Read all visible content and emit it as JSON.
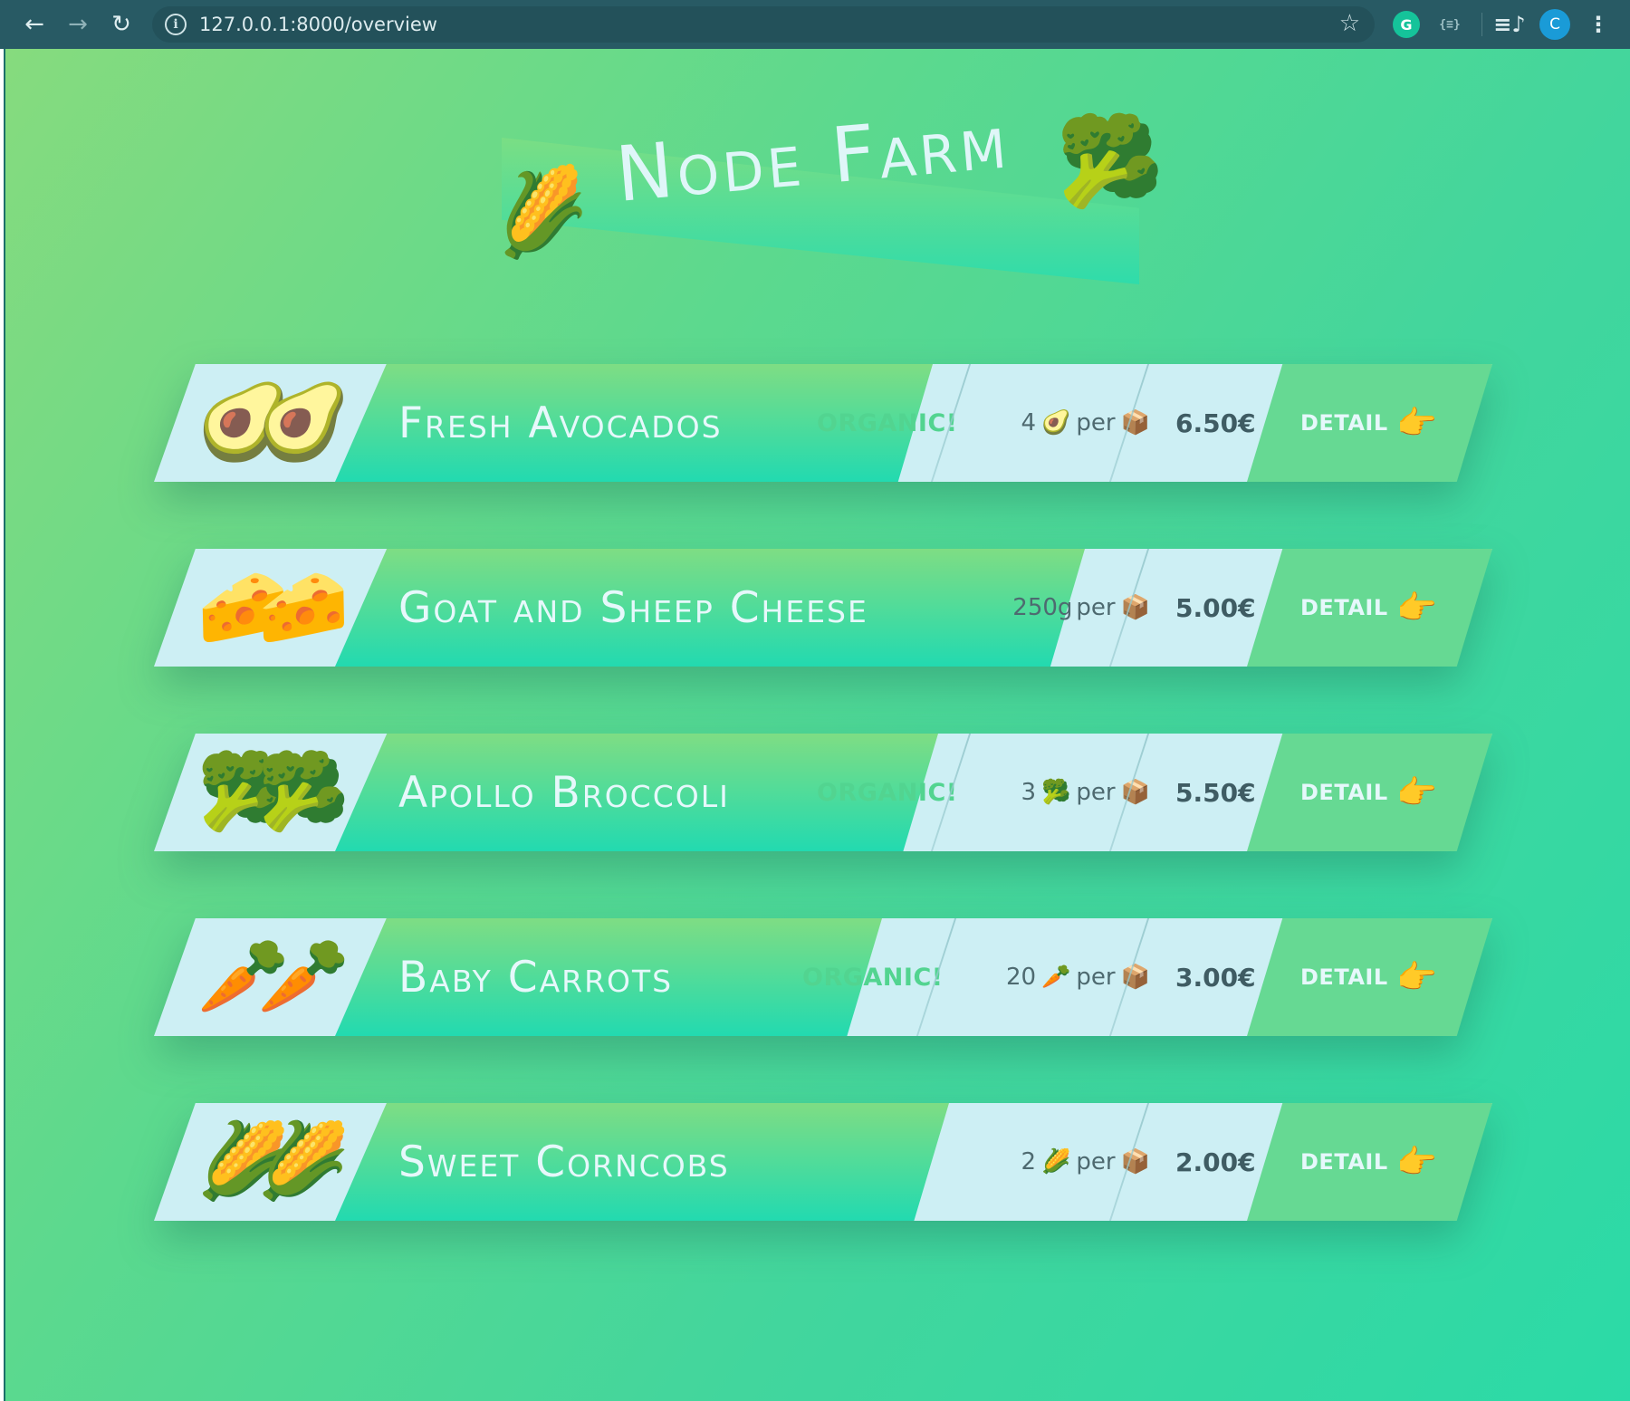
{
  "browser": {
    "back": "←",
    "forward": "→",
    "reload": "↻",
    "url": "127.0.0.1:8000/overview",
    "star": "☆",
    "ext_grammarly": "G",
    "ext_json": "{≡}",
    "ext_list": "≡♪",
    "avatar_letter": "C",
    "menu": "⋮"
  },
  "header": {
    "title": "Node Farm",
    "emoji_left": "🌽",
    "emoji_right": "🥦"
  },
  "colors": {
    "page_gradient_start": "#86db7e",
    "page_gradient_end": "#2bdaa7",
    "card_background": "#cdeff4",
    "organic_text": "#52d490",
    "detail_zone": "#66d993"
  },
  "products": [
    {
      "name": "Fresh Avocados",
      "image": "🥑🥑",
      "organic_label": "ORGANIC!",
      "quantity_amount": "4",
      "quantity_emoji": "🥑",
      "quantity_per": "per",
      "box_emoji": "📦",
      "price": "6.50€",
      "detail_label": "DETAIL",
      "detail_icon": "👉"
    },
    {
      "name": "Goat and Sheep Cheese",
      "image": "🧀🧀",
      "organic_label": "",
      "quantity_amount": "250g",
      "quantity_emoji": "",
      "quantity_per": "per",
      "box_emoji": "📦",
      "price": "5.00€",
      "detail_label": "DETAIL",
      "detail_icon": "👉"
    },
    {
      "name": "Apollo Broccoli",
      "image": "🥦🥦",
      "organic_label": "ORGANIC!",
      "quantity_amount": "3",
      "quantity_emoji": "🥦",
      "quantity_per": "per",
      "box_emoji": "📦",
      "price": "5.50€",
      "detail_label": "DETAIL",
      "detail_icon": "👉"
    },
    {
      "name": "Baby Carrots",
      "image": "🥕🥕",
      "organic_label": "ORGANIC!",
      "quantity_amount": "20",
      "quantity_emoji": "🥕",
      "quantity_per": "per",
      "box_emoji": "📦",
      "price": "3.00€",
      "detail_label": "DETAIL",
      "detail_icon": "👉"
    },
    {
      "name": "Sweet Corncobs",
      "image": "🌽🌽",
      "organic_label": "",
      "quantity_amount": "2",
      "quantity_emoji": "🌽",
      "quantity_per": "per",
      "box_emoji": "📦",
      "price": "2.00€",
      "detail_label": "DETAIL",
      "detail_icon": "👉"
    }
  ]
}
